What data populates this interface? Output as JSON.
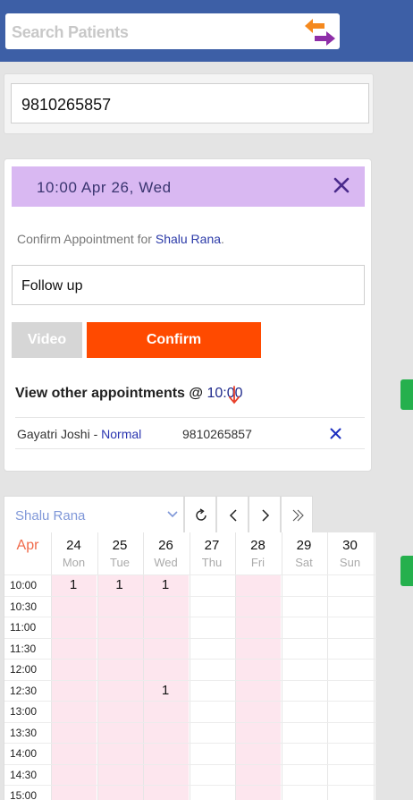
{
  "search": {
    "placeholder": "Search Patients"
  },
  "phone_input": {
    "value": "9810265857"
  },
  "appointment": {
    "time_label": "10:00 Apr 26, Wed",
    "confirm_prefix": "Confirm Appointment for ",
    "patient_name": "Shalu Rana",
    "confirm_suffix": ".",
    "type_value": "Follow up",
    "video_label": "Video",
    "confirm_label": "Confirm",
    "view_other_prefix": "View other appointments @ ",
    "view_other_time": "10:00",
    "other": [
      {
        "name": "Gayatri Joshi",
        "separator": " - ",
        "type": "Normal",
        "phone": "9810265857"
      }
    ]
  },
  "calendar": {
    "doctor": "Shalu Rana",
    "month": "Apr",
    "days": [
      {
        "num": "24",
        "name": "Mon"
      },
      {
        "num": "25",
        "name": "Tue"
      },
      {
        "num": "26",
        "name": "Wed"
      },
      {
        "num": "27",
        "name": "Thu"
      },
      {
        "num": "28",
        "name": "Fri"
      },
      {
        "num": "29",
        "name": "Sat"
      },
      {
        "num": "30",
        "name": "Sun"
      }
    ],
    "times": [
      "10:00",
      "10:30",
      "11:00",
      "11:30",
      "12:00",
      "12:30",
      "13:00",
      "13:30",
      "14:00",
      "14:30",
      "15:00"
    ],
    "counts": [
      {
        "day": "24",
        "time": "10:00",
        "value": "1"
      },
      {
        "day": "25",
        "time": "10:00",
        "value": "1"
      },
      {
        "day": "26",
        "time": "10:00",
        "value": "1"
      },
      {
        "day": "26",
        "time": "12:30",
        "value": "1"
      }
    ],
    "highlight_days": [
      "24",
      "25",
      "26",
      "28"
    ]
  },
  "colors": {
    "topbar": "#3d5fa6",
    "confirm": "#ff4a00",
    "appt_header": "#d9b8f2",
    "accent_link": "#2b3aa8",
    "highlight": "#fde6ee"
  }
}
